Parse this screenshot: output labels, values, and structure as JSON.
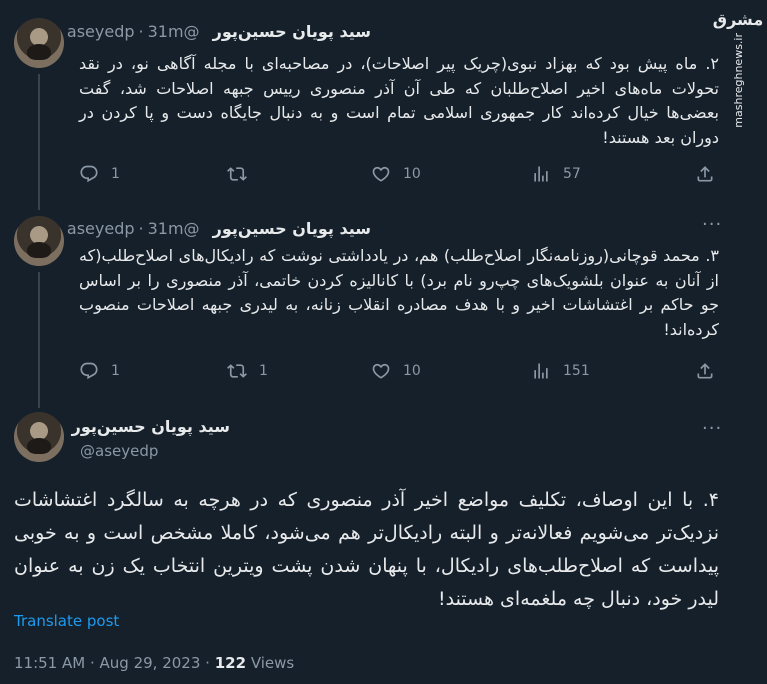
{
  "watermark": {
    "logo_text": "مشرق",
    "url": "mashreghnews.ir"
  },
  "tweets": [
    {
      "name": "سید پویان حسین‌پور",
      "handle": "@aseyedp",
      "time": "31m",
      "text": "۲. ماه پیش بود که بهزاد نبوی(چریک پیر اصلاحات)، در مصاحبه‌ای با مجله آگاهی نو، در نقد تحولات ماه‌های اخیر اصلاح‌طلبان که طی آن آذر منصوری رییس جبهه اصلاحات شد، گفت بعضی‌ها خیال کرده‌اند کار جمهوری اسلامی تمام است و به دنبال جایگاه دست و پا کردن در دوران بعد هستند!",
      "replies": "1",
      "retweets": "",
      "likes": "10",
      "views": "57"
    },
    {
      "name": "سید پویان حسین‌پور",
      "handle": "@aseyedp",
      "time": "31m",
      "text": "۳. محمد قوچانی(روزنامه‌نگار اصلاح‌طلب) هم، در یادداشتی نوشت که رادیکال‌های اصلاح‌طلب(که از آنان به عنوان بلشویک‌های چپ‌رو نام برد) با کانالیزه کردن خاتمی، آذر منصوری را بر اساس جو حاکم بر اغتشاشات اخیر و با هدف مصادره انقلاب زنانه، به لیدری جبهه اصلاحات منصوب کرده‌اند!",
      "replies": "1",
      "retweets": "1",
      "likes": "10",
      "views": "151"
    }
  ],
  "main": {
    "name": "سید پویان حسین‌پور",
    "handle": "@aseyedp",
    "text": "۴. با این اوصاف، تکلیف مواضع اخیر آذر منصوری که در هرچه به سالگرد اغتشاشات نزدیک‌تر می‌شویم فعالانه‌تر و البته رادیکال‌تر هم می‌شود، کاملا مشخص است و به خوبی پیداست که اصلاح‌طلب‌های رادیکال، با پنهان شدن پشت ویترین انتخاب یک زن به عنوان لیدر خود، دنبال چه ملغمه‌ای هستند!",
    "translate": "Translate post",
    "time": "11:51 AM",
    "date": "Aug 29, 2023",
    "views_count": "122",
    "views_label": "Views"
  },
  "colors": {
    "bg": "#15202b",
    "text": "#e7e9ea",
    "muted": "#8b98a5",
    "link": "#1d9bf0",
    "border": "#38444d"
  },
  "icons": [
    "reply-icon",
    "retweet-icon",
    "like-icon",
    "views-icon",
    "share-icon",
    "more-icon"
  ]
}
